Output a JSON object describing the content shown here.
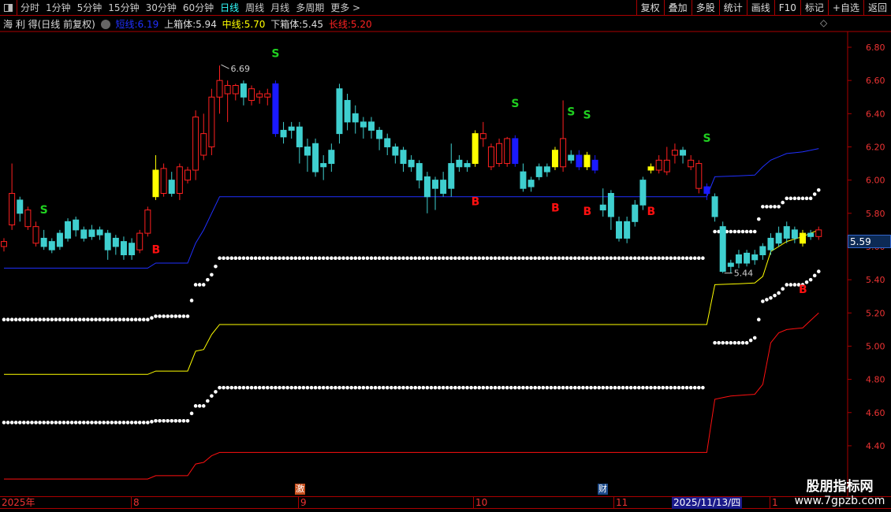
{
  "toolbar": {
    "periods": [
      "分时",
      "1分钟",
      "5分钟",
      "15分钟",
      "30分钟",
      "60分钟",
      "日线",
      "周线",
      "月线",
      "多周期",
      "更多 >"
    ],
    "active_period": "日线",
    "right_buttons": [
      "复权",
      "叠加",
      "多股",
      "统计",
      "画线",
      "F10",
      "标记",
      "+自选",
      "返回"
    ]
  },
  "legend": {
    "stock": "海 利 得(日线 前复权)",
    "short_label": "短线:",
    "short_value": "6.19",
    "upper_label": "上箱体:",
    "upper_value": "5.94",
    "mid_label": "中线:",
    "mid_value": "5.70",
    "lower_label": "下箱体:",
    "lower_value": "5.45",
    "long_label": "长线:",
    "long_value": "5.20"
  },
  "topright_icon": "◇",
  "price_tag": "5.59",
  "xaxis": {
    "labels": [
      "2025年",
      "8",
      "9",
      "10",
      "11",
      "1"
    ],
    "current_date": "2025/11/13/四"
  },
  "events": [
    {
      "text": "激",
      "color": "#c8501e"
    },
    {
      "text": "财",
      "color": "#1c4a8a"
    }
  ],
  "watermark": {
    "title": "股朋指标网",
    "url": "www.7gpzb.com"
  },
  "colors": {
    "up": "#ff2020",
    "down": "#3fcfcf",
    "short": "#2030ff",
    "mid": "#ffff00",
    "long": "#ff1010",
    "box": "#ffffff",
    "signal_s": "#20d020",
    "signal_b": "#ff1010",
    "highlight_yellow": "#ffff00",
    "highlight_blue": "#1a1aff"
  },
  "chart_data": {
    "type": "candlestick",
    "ylim": [
      4.3,
      6.9
    ],
    "yticks": [
      "6.80",
      "6.60",
      "6.40",
      "6.20",
      "6.00",
      "5.80",
      "5.60",
      "5.40",
      "5.20",
      "5.00",
      "4.80",
      "4.60",
      "4.40"
    ],
    "ohlc": [
      [
        5.6,
        5.65,
        5.57,
        5.63
      ],
      [
        5.73,
        6.1,
        5.7,
        5.92
      ],
      [
        5.88,
        5.9,
        5.75,
        5.8
      ],
      [
        5.72,
        5.84,
        5.7,
        5.82
      ],
      [
        5.62,
        5.75,
        5.6,
        5.72
      ],
      [
        5.65,
        5.7,
        5.58,
        5.6
      ],
      [
        5.63,
        5.65,
        5.56,
        5.58
      ],
      [
        5.68,
        5.7,
        5.58,
        5.6
      ],
      [
        5.75,
        5.77,
        5.63,
        5.65
      ],
      [
        5.76,
        5.78,
        5.66,
        5.7
      ],
      [
        5.7,
        5.72,
        5.63,
        5.65
      ],
      [
        5.7,
        5.73,
        5.64,
        5.66
      ],
      [
        5.7,
        5.72,
        5.64,
        5.67
      ],
      [
        5.68,
        5.7,
        5.52,
        5.58
      ],
      [
        5.65,
        5.67,
        5.55,
        5.6
      ],
      [
        5.63,
        5.66,
        5.52,
        5.55
      ],
      [
        5.62,
        5.65,
        5.52,
        5.55
      ],
      [
        5.58,
        5.7,
        5.56,
        5.68
      ],
      [
        5.68,
        5.84,
        5.66,
        5.82
      ],
      [
        5.9,
        6.15,
        5.88,
        6.06
      ],
      [
        5.92,
        6.1,
        5.9,
        6.07
      ],
      [
        6.0,
        6.05,
        5.9,
        5.92
      ],
      [
        5.92,
        6.1,
        5.88,
        6.08
      ],
      [
        6.0,
        6.08,
        5.98,
        6.06
      ],
      [
        6.06,
        6.42,
        6.0,
        6.38
      ],
      [
        6.15,
        6.4,
        6.12,
        6.28
      ],
      [
        6.2,
        6.55,
        6.15,
        6.5
      ],
      [
        6.5,
        6.69,
        6.4,
        6.6
      ],
      [
        6.52,
        6.6,
        6.35,
        6.57
      ],
      [
        6.52,
        6.58,
        6.48,
        6.57
      ],
      [
        6.58,
        6.6,
        6.45,
        6.5
      ],
      [
        6.48,
        6.57,
        6.45,
        6.55
      ],
      [
        6.5,
        6.54,
        6.46,
        6.52
      ],
      [
        6.5,
        6.55,
        6.45,
        6.52
      ],
      [
        6.58,
        6.6,
        6.26,
        6.28
      ],
      [
        6.3,
        6.35,
        6.22,
        6.26
      ],
      [
        6.32,
        6.35,
        6.25,
        6.3
      ],
      [
        6.32,
        6.35,
        6.1,
        6.2
      ],
      [
        6.2,
        6.25,
        6.05,
        6.15
      ],
      [
        6.22,
        6.25,
        6.02,
        6.05
      ],
      [
        6.1,
        6.15,
        6.0,
        6.08
      ],
      [
        6.18,
        6.22,
        6.05,
        6.1
      ],
      [
        6.55,
        6.58,
        6.22,
        6.28
      ],
      [
        6.48,
        6.52,
        6.3,
        6.35
      ],
      [
        6.4,
        6.45,
        6.28,
        6.35
      ],
      [
        6.35,
        6.38,
        6.25,
        6.32
      ],
      [
        6.35,
        6.38,
        6.25,
        6.3
      ],
      [
        6.3,
        6.32,
        6.18,
        6.25
      ],
      [
        6.25,
        6.28,
        6.15,
        6.2
      ],
      [
        6.2,
        6.22,
        6.1,
        6.15
      ],
      [
        6.18,
        6.2,
        6.05,
        6.1
      ],
      [
        6.12,
        6.15,
        6.05,
        6.08
      ],
      [
        6.1,
        6.12,
        5.95,
        6.0
      ],
      [
        6.02,
        6.05,
        5.8,
        5.9
      ],
      [
        6.0,
        6.02,
        5.82,
        5.95
      ],
      [
        6.0,
        6.05,
        5.9,
        5.92
      ],
      [
        6.1,
        6.22,
        5.9,
        5.95
      ],
      [
        6.12,
        6.15,
        6.05,
        6.08
      ],
      [
        6.1,
        6.12,
        6.05,
        6.08
      ],
      [
        6.28,
        6.3,
        6.08,
        6.1
      ],
      [
        6.25,
        6.35,
        6.2,
        6.28
      ],
      [
        6.08,
        6.22,
        6.06,
        6.2
      ],
      [
        6.1,
        6.25,
        6.08,
        6.22
      ],
      [
        6.1,
        6.26,
        6.08,
        6.25
      ],
      [
        6.25,
        6.27,
        6.08,
        6.1
      ],
      [
        6.05,
        6.1,
        5.93,
        5.95
      ],
      [
        6.0,
        6.02,
        5.93,
        5.96
      ],
      [
        6.08,
        6.1,
        6.0,
        6.02
      ],
      [
        6.08,
        6.1,
        6.02,
        6.05
      ],
      [
        6.18,
        6.2,
        6.06,
        6.08
      ],
      [
        6.08,
        6.48,
        6.05,
        6.25
      ],
      [
        6.15,
        6.18,
        6.1,
        6.12
      ],
      [
        6.15,
        6.18,
        6.06,
        6.08
      ],
      [
        6.15,
        6.17,
        6.06,
        6.08
      ],
      [
        6.12,
        6.15,
        6.04,
        6.06
      ],
      [
        5.85,
        5.95,
        5.78,
        5.82
      ],
      [
        5.92,
        5.94,
        5.7,
        5.78
      ],
      [
        5.75,
        5.78,
        5.63,
        5.65
      ],
      [
        5.75,
        5.78,
        5.62,
        5.65
      ],
      [
        5.85,
        5.88,
        5.72,
        5.75
      ],
      [
        6.0,
        6.02,
        5.82,
        5.85
      ],
      [
        6.08,
        6.1,
        6.04,
        6.06
      ],
      [
        6.06,
        6.15,
        6.04,
        6.12
      ],
      [
        6.05,
        6.2,
        6.03,
        6.12
      ],
      [
        6.15,
        6.22,
        6.1,
        6.18
      ],
      [
        6.18,
        6.2,
        6.1,
        6.15
      ],
      [
        6.08,
        6.15,
        6.06,
        6.12
      ],
      [
        5.95,
        6.12,
        5.92,
        6.1
      ],
      [
        5.96,
        5.98,
        5.88,
        5.92
      ],
      [
        5.9,
        5.92,
        5.75,
        5.78
      ],
      [
        5.72,
        5.75,
        5.44,
        5.45
      ],
      [
        5.5,
        5.52,
        5.44,
        5.48
      ],
      [
        5.55,
        5.58,
        5.47,
        5.5
      ],
      [
        5.56,
        5.58,
        5.48,
        5.5
      ],
      [
        5.55,
        5.58,
        5.49,
        5.52
      ],
      [
        5.6,
        5.62,
        5.52,
        5.55
      ],
      [
        5.65,
        5.68,
        5.55,
        5.58
      ],
      [
        5.68,
        5.72,
        5.6,
        5.62
      ],
      [
        5.72,
        5.75,
        5.62,
        5.65
      ],
      [
        5.7,
        5.72,
        5.62,
        5.65
      ],
      [
        5.68,
        5.7,
        5.6,
        5.62
      ],
      [
        5.68,
        5.7,
        5.64,
        5.66
      ],
      [
        5.66,
        5.72,
        5.64,
        5.7
      ]
    ],
    "highlight_yellow": [
      19,
      59,
      69,
      73,
      81,
      100
    ],
    "highlight_blue": [
      34,
      64,
      72,
      74,
      88
    ],
    "series": [
      {
        "name": "短线",
        "style": "line",
        "color": "#2030ff",
        "steps": [
          [
            0,
            5.47
          ],
          [
            18,
            5.47
          ],
          [
            19,
            5.5
          ],
          [
            23,
            5.5
          ],
          [
            24,
            5.62
          ],
          [
            25,
            5.7
          ],
          [
            26,
            5.8
          ],
          [
            27,
            5.9
          ],
          [
            88,
            5.9
          ],
          [
            89,
            6.02
          ],
          [
            94,
            6.03
          ],
          [
            95,
            6.08
          ],
          [
            96,
            6.12
          ],
          [
            98,
            6.16
          ],
          [
            100,
            6.17
          ],
          [
            102,
            6.19
          ]
        ]
      },
      {
        "name": "中线",
        "style": "line",
        "color": "#ffff00",
        "steps": [
          [
            0,
            4.83
          ],
          [
            18,
            4.83
          ],
          [
            19,
            4.85
          ],
          [
            23,
            4.85
          ],
          [
            24,
            4.97
          ],
          [
            25,
            4.98
          ],
          [
            26,
            5.07
          ],
          [
            27,
            5.13
          ],
          [
            88,
            5.13
          ],
          [
            89,
            5.37
          ],
          [
            94,
            5.38
          ],
          [
            95,
            5.42
          ],
          [
            96,
            5.57
          ],
          [
            97,
            5.6
          ],
          [
            98,
            5.63
          ],
          [
            100,
            5.66
          ],
          [
            102,
            5.7
          ]
        ]
      },
      {
        "name": "长线",
        "style": "line",
        "color": "#ff1010",
        "steps": [
          [
            0,
            4.2
          ],
          [
            18,
            4.2
          ],
          [
            19,
            4.22
          ],
          [
            23,
            4.22
          ],
          [
            24,
            4.29
          ],
          [
            25,
            4.3
          ],
          [
            26,
            4.34
          ],
          [
            27,
            4.36
          ],
          [
            88,
            4.36
          ],
          [
            89,
            4.68
          ],
          [
            91,
            4.7
          ],
          [
            94,
            4.71
          ],
          [
            95,
            4.77
          ],
          [
            96,
            5.02
          ],
          [
            97,
            5.08
          ],
          [
            98,
            5.1
          ],
          [
            100,
            5.11
          ],
          [
            102,
            5.2
          ]
        ]
      },
      {
        "name": "上箱体",
        "style": "dots",
        "color": "#ffffff",
        "steps": [
          [
            0,
            5.16
          ],
          [
            18,
            5.16
          ],
          [
            19,
            5.18
          ],
          [
            23,
            5.18
          ],
          [
            24,
            5.37
          ],
          [
            25,
            5.37
          ],
          [
            26,
            5.43
          ],
          [
            27,
            5.53
          ],
          [
            88,
            5.53
          ],
          [
            89,
            5.69
          ],
          [
            94,
            5.69
          ],
          [
            95,
            5.84
          ],
          [
            97,
            5.84
          ],
          [
            98,
            5.89
          ],
          [
            101,
            5.89
          ],
          [
            102,
            5.94
          ]
        ]
      },
      {
        "name": "下箱体",
        "style": "dots",
        "color": "#ffffff",
        "steps": [
          [
            0,
            4.54
          ],
          [
            18,
            4.54
          ],
          [
            19,
            4.55
          ],
          [
            23,
            4.55
          ],
          [
            24,
            4.64
          ],
          [
            25,
            4.64
          ],
          [
            26,
            4.7
          ],
          [
            27,
            4.75
          ],
          [
            88,
            4.75
          ],
          [
            89,
            5.02
          ],
          [
            93,
            5.02
          ],
          [
            94,
            5.05
          ],
          [
            95,
            5.27
          ],
          [
            96,
            5.29
          ],
          [
            97,
            5.32
          ],
          [
            98,
            5.37
          ],
          [
            100,
            5.37
          ],
          [
            101,
            5.4
          ],
          [
            102,
            5.45
          ]
        ]
      }
    ],
    "signals": [
      {
        "type": "S",
        "index": 5,
        "price": 5.8
      },
      {
        "type": "S",
        "index": 34,
        "price": 6.74
      },
      {
        "type": "S",
        "index": 64,
        "price": 6.44
      },
      {
        "type": "S",
        "index": 71,
        "price": 6.39
      },
      {
        "type": "S",
        "index": 73,
        "price": 6.37
      },
      {
        "type": "S",
        "index": 88,
        "price": 6.23
      },
      {
        "type": "B",
        "index": 19,
        "price": 5.56
      },
      {
        "type": "B",
        "index": 59,
        "price": 5.85
      },
      {
        "type": "B",
        "index": 69,
        "price": 5.81
      },
      {
        "type": "B",
        "index": 73,
        "price": 5.79
      },
      {
        "type": "B",
        "index": 81,
        "price": 5.79
      },
      {
        "type": "B",
        "index": 100,
        "price": 5.32
      }
    ],
    "annotations": [
      {
        "index": 27,
        "text": "6.69",
        "price": 6.69
      },
      {
        "index": 90,
        "text": "5.44",
        "price": 5.44
      }
    ]
  }
}
